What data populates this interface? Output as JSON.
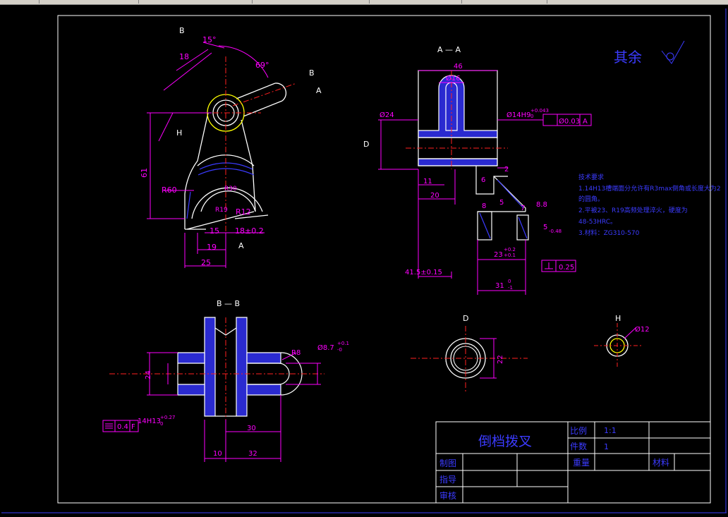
{
  "window": {
    "chrome_color": "#d4d0c8"
  },
  "drawing": {
    "section_aa": "A — A",
    "section_bb": "B — B",
    "view_d": "D",
    "view_h": "H",
    "label_a": "A",
    "label_b": "B",
    "label_d": "D",
    "label_h": "H",
    "surface_rest": "其余",
    "dims_left": {
      "ang15": "15°",
      "d18": "18",
      "ang69": "69°",
      "d61": "61",
      "r60": "R60",
      "r12": "R12",
      "d15": "15",
      "d18t": "18±0.2",
      "d19": "19",
      "d25": "25",
      "r30": "R30",
      "r19": "R19"
    },
    "dims_aa": {
      "d46": "46",
      "d16": "Ø16",
      "d24": "Ø24",
      "d14h9": "Ø14H9",
      "tol_up": "+0.043",
      "tol_lo": "0",
      "frame_tol": "Ø0.03",
      "frame_ref": "A",
      "d2": "2",
      "d11": "11",
      "d20": "20",
      "d6": "6",
      "d8": "8",
      "d5": "5",
      "d7": "7",
      "d88": "8.8",
      "d5b": "5",
      "d5b_tol": "-0.48",
      "d23": "23",
      "d23_tol_up": "+0.2",
      "d23_tol_lo": "+0.1",
      "d415": "41.5±0.15",
      "d31": "31",
      "d31_tol_up": "0",
      "d31_tol_lo": "-1",
      "perp": "0.25"
    },
    "dims_bb": {
      "r8": "R8",
      "d87": "Ø8.7",
      "d87_tol_up": "+0.1",
      "d87_tol_lo": "-0",
      "d24": "24",
      "d30": "30",
      "d10": "10",
      "d32": "32",
      "d14h13": "14H13",
      "tol_up": "+0.27",
      "tol_lo": "0",
      "sym": "0.4",
      "sym_ref": "F"
    },
    "dims_d": {
      "d22": "22"
    },
    "dims_h": {
      "d12": "Ø12"
    }
  },
  "notes": {
    "title": "技术要求",
    "lines": [
      "1.14H13槽端面分允许有R3max倒角或长度大为2",
      "的圆角。",
      "2.平被23、R19高频处理淬火，硬度为",
      "48-53HRC。",
      "3.材料：ZG310-570"
    ]
  },
  "title_block": {
    "part_name": "倒档拨叉",
    "scale_label": "比例",
    "scale_value": "1:1",
    "qty_label": "件数",
    "qty_value": "1",
    "weight_label": "重量",
    "material_label": "材料",
    "drawn_label": "制图",
    "design_label": "指导",
    "check_label": "审核"
  },
  "colors": {
    "border": "#ffffff",
    "outline": "#ffffff",
    "dimension": "#ff00ff",
    "centerline": "#ff2020",
    "hatch": "#3b3bff",
    "text_blue": "#3b3bff",
    "yellow": "#ffff00",
    "tolerance": "#00e000"
  }
}
